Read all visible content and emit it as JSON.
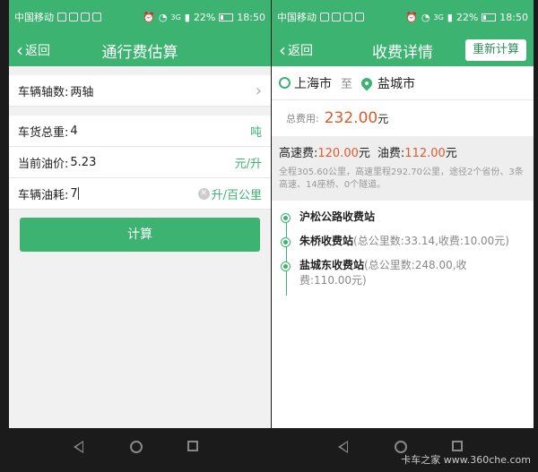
{
  "status": {
    "carrier": "中国移动",
    "network": "3G",
    "battery": "22%",
    "time": "18:50"
  },
  "left": {
    "back_label": "返回",
    "title": "通行费估算",
    "axles": {
      "label": "车辆轴数:",
      "value": "两轴"
    },
    "weight": {
      "label": "车货总重:",
      "value": "4",
      "unit": "吨"
    },
    "oil_price": {
      "label": "当前油价:",
      "value": "5.23",
      "unit": "元/升"
    },
    "fuel_use": {
      "label": "车辆油耗:",
      "value": "7",
      "unit": "升/百公里"
    },
    "calc_label": "计算"
  },
  "right": {
    "back_label": "返回",
    "title": "收费详情",
    "action_label": "重新计算",
    "from": "上海市",
    "to_word": "至",
    "to": "盐城市",
    "total_label": "总费用:",
    "total_amount": "232.00",
    "yuan": "元",
    "highway_label": "高速费:",
    "highway_amount": "120.00",
    "oil_label": "油费:",
    "oil_amount": "112.00",
    "summary": "全程305.60公里，高速里程292.70公里，途径2个省份、3条高速、14座桥、0个隧道。",
    "stations": [
      {
        "name": "沪松公路收费站",
        "detail": ""
      },
      {
        "name": "朱桥收费站",
        "detail": "(总公里数:33.14,收费:10.00元)"
      },
      {
        "name": "盐城东收费站",
        "detail": "(总公里数:248.00,收费:110.00元)"
      }
    ]
  },
  "watermark": "卡车之家 www.360che.com",
  "colors": {
    "accent": "#3cb371",
    "price": "#e05a2a"
  }
}
